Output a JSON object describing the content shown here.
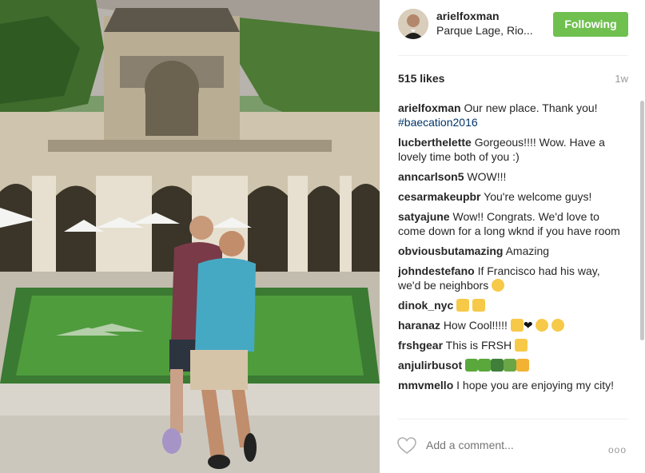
{
  "post": {
    "username": "arielfoxman",
    "location": "Parque Lage, Rio...",
    "follow_label": "Following",
    "likes": "515 likes",
    "time_ago": "1w",
    "add_comment_placeholder": "Add a comment...",
    "more_label": "ooo"
  },
  "comments": [
    {
      "user": "arielfoxman",
      "text": "Our new place. Thank you!",
      "hashtag": "#baecation2016"
    },
    {
      "user": "lucberthelette",
      "text": "Gorgeous!!!! Wow. Have a lovely time both of you :)"
    },
    {
      "user": "anncarlson5",
      "text": "WOW!!!"
    },
    {
      "user": "cesarmakeupbr",
      "text": "You're welcome guys!"
    },
    {
      "user": "satyajune",
      "text": "Wow!! Congrats. We'd love to come down for a long wknd if you have room"
    },
    {
      "user": "obviousbutamazing",
      "text": "Amazing"
    },
    {
      "user": "johndestefano",
      "text": "If Francisco had his way, we'd be neighbors"
    },
    {
      "user": "dinok_nyc",
      "text": ""
    },
    {
      "user": "haranaz",
      "text": "How Cool!!!!!"
    },
    {
      "user": "frshgear",
      "text": "This is FRSH"
    },
    {
      "user": "anjulirbusot",
      "text": ""
    },
    {
      "user": "mmvmello",
      "text": "I hope you are enjoying my city!"
    }
  ],
  "colors": {
    "follow_button": "#70c050",
    "hashtag": "#003569",
    "muted": "#999999"
  },
  "icons": [
    "heart-icon",
    "more-options-icon"
  ]
}
